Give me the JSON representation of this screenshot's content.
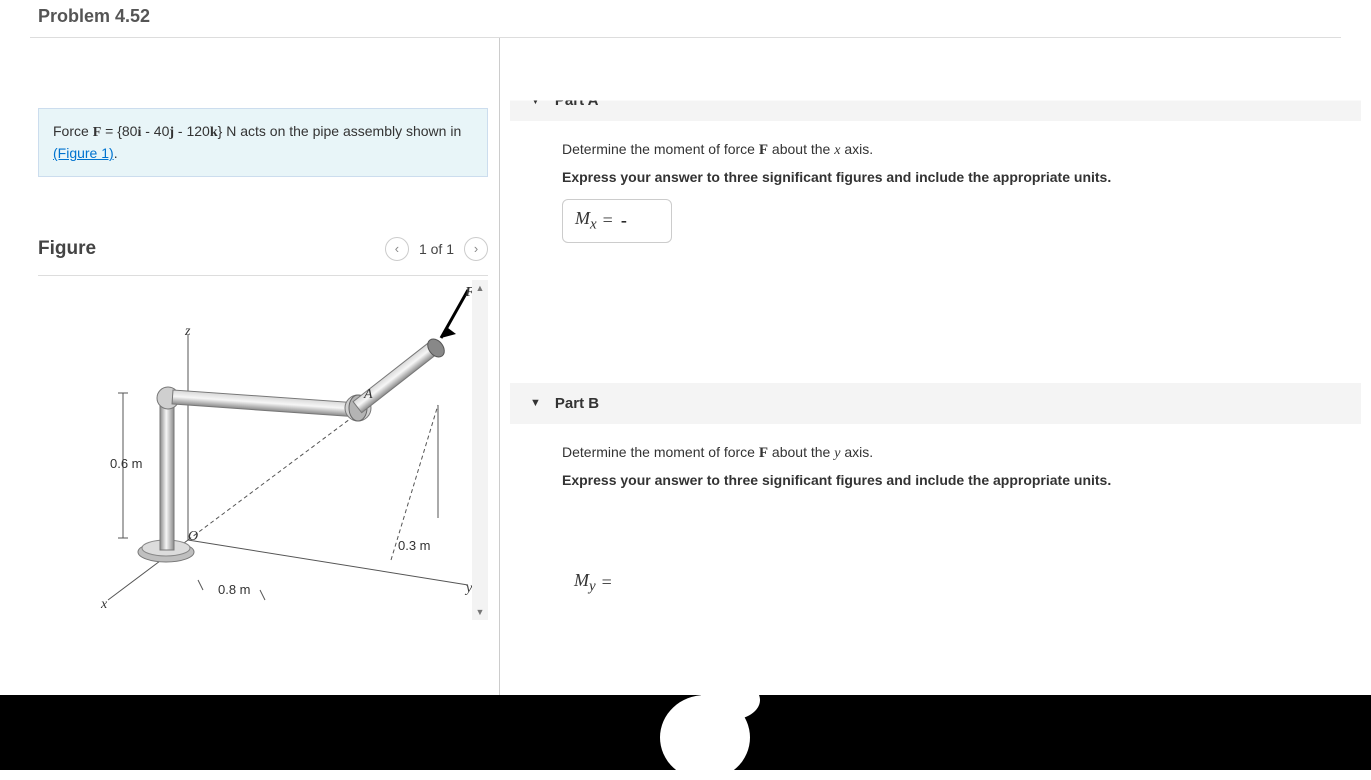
{
  "problem_title": "Problem 4.52",
  "info": {
    "prefix": "Force ",
    "force_symbol": "F",
    "eq": " = {80",
    "i": "i",
    "mid1": " - 40",
    "j": "j",
    "mid2": " - 120",
    "k": "k",
    "unit": "} N",
    "suffix": " acts on the pipe assembly shown in ",
    "link_text": "(Figure 1)",
    "period": "."
  },
  "figure": {
    "title": "Figure",
    "counter": "1 of 1",
    "labels": {
      "F": "F",
      "A": "A",
      "O": "O",
      "z": "z",
      "x": "x",
      "y": "y",
      "d1": "0.6 m",
      "d2": "0.8 m",
      "d3": "0.3 m"
    }
  },
  "partA": {
    "header": "Part A",
    "instr1_pre": "Determine the moment of force ",
    "instr1_F": "F",
    "instr1_mid": " about the ",
    "instr1_axis": "x",
    "instr1_post": " axis.",
    "instr2": "Express your answer to three significant figures and include the appropriate units.",
    "var": "M",
    "sub": "x",
    "eq": " = ",
    "value": "-"
  },
  "partB": {
    "header": "Part B",
    "instr1_pre": "Determine the moment of force ",
    "instr1_F": "F",
    "instr1_mid": " about the ",
    "instr1_axis": "y",
    "instr1_post": " axis.",
    "instr2": "Express your answer to three significant figures and include the appropriate units.",
    "var": "M",
    "sub": "y",
    "eq": " =",
    "value": ""
  }
}
